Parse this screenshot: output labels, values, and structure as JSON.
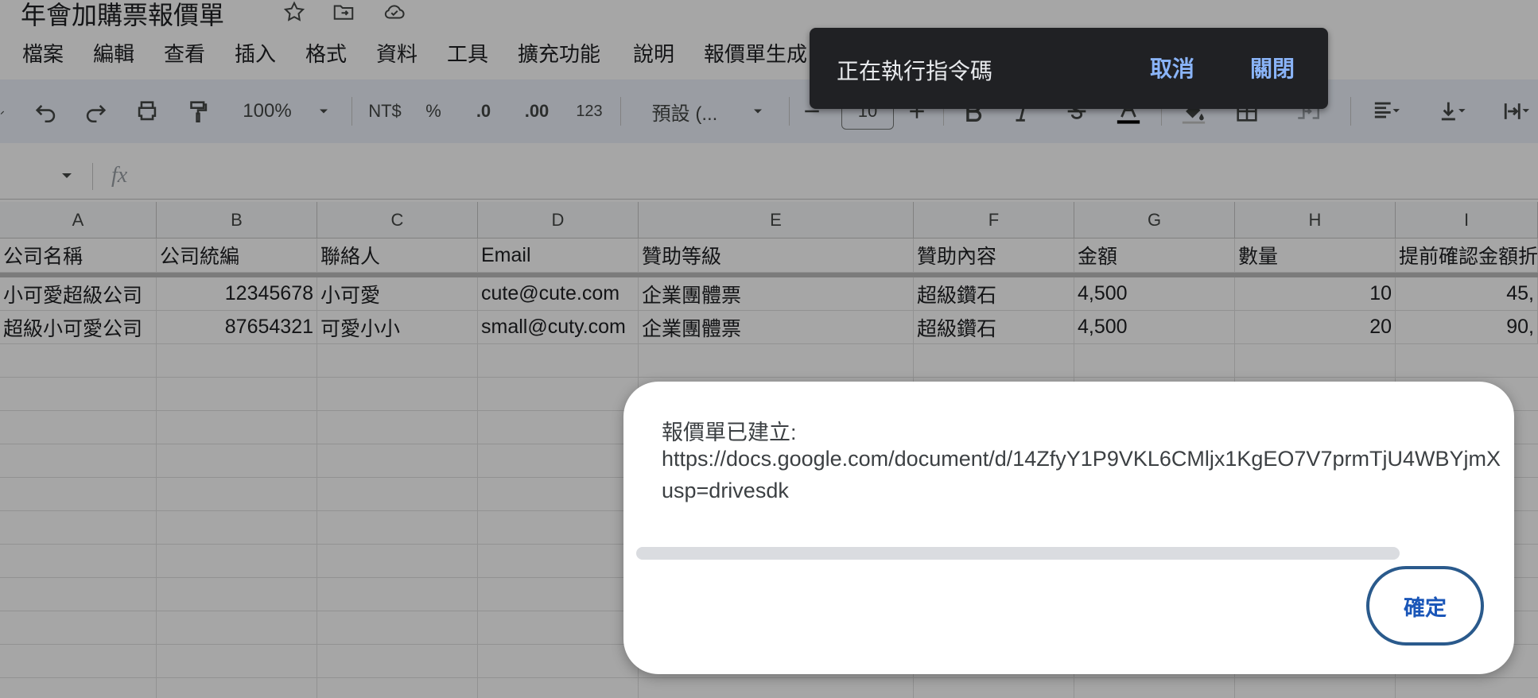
{
  "doc": {
    "title": "年會加購票報價單"
  },
  "menu": [
    "檔案",
    "編輯",
    "查看",
    "插入",
    "格式",
    "資料",
    "工具",
    "擴充功能",
    "說明",
    "報價單生成"
  ],
  "toolbar": {
    "zoom": "100%",
    "currency": "NT$",
    "percent": "%",
    "decrease_decimal": ".0",
    "increase_decimal": ".00",
    "number_format": "123",
    "font": "預設 (...",
    "font_size": "10"
  },
  "formula_bar": {
    "fx": "fx"
  },
  "sheet": {
    "columns": [
      "A",
      "B",
      "C",
      "D",
      "E",
      "F",
      "G",
      "H",
      "I"
    ],
    "header_row": [
      "公司名稱",
      "公司統編",
      "聯絡人",
      "Email",
      "贊助等級",
      "贊助內容",
      "金額",
      "數量",
      "提前確認金額折"
    ],
    "rows": [
      [
        "小可愛超級公司",
        "12345678",
        "小可愛",
        "cute@cute.com",
        "企業團體票",
        "超級鑽石",
        "4,500",
        "10",
        "45,"
      ],
      [
        "超級小可愛公司",
        "87654321",
        "可愛小小",
        "small@cuty.com",
        "企業團體票",
        "超級鑽石",
        "4,500",
        "20",
        "90,"
      ]
    ]
  },
  "snackbar": {
    "text": "正在執行指令碼",
    "cancel": "取消",
    "close": "關閉"
  },
  "dialog": {
    "line1": "報價單已建立:",
    "line2": "https://docs.google.com/document/d/14ZfyY1P9VKL6CMljx1KgEO7V7prmTjU4WBYjmX",
    "line3": "usp=drivesdk",
    "ok": "確定"
  },
  "colors": {
    "accent": "#1a56b8",
    "snackbar_bg": "#202124",
    "snackbar_action": "#8ab4f8",
    "overlay": "rgba(0,0,0,0.35)"
  }
}
